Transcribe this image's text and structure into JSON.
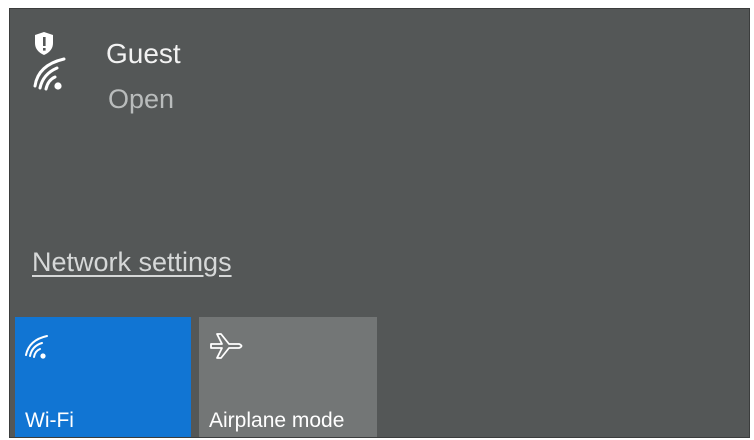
{
  "network": {
    "name": "Guest",
    "status": "Open",
    "icon": "wifi-secured-icon"
  },
  "settings_link": "Network settings",
  "quick_actions": {
    "wifi": {
      "label": "Wi-Fi",
      "icon": "wifi-icon",
      "state": "on",
      "color": "#1175d3"
    },
    "airplane": {
      "label": "Airplane mode",
      "icon": "airplane-icon",
      "state": "off",
      "color": "#737676"
    }
  },
  "colors": {
    "panel_bg": "#545757",
    "accent": "#1175d3"
  }
}
